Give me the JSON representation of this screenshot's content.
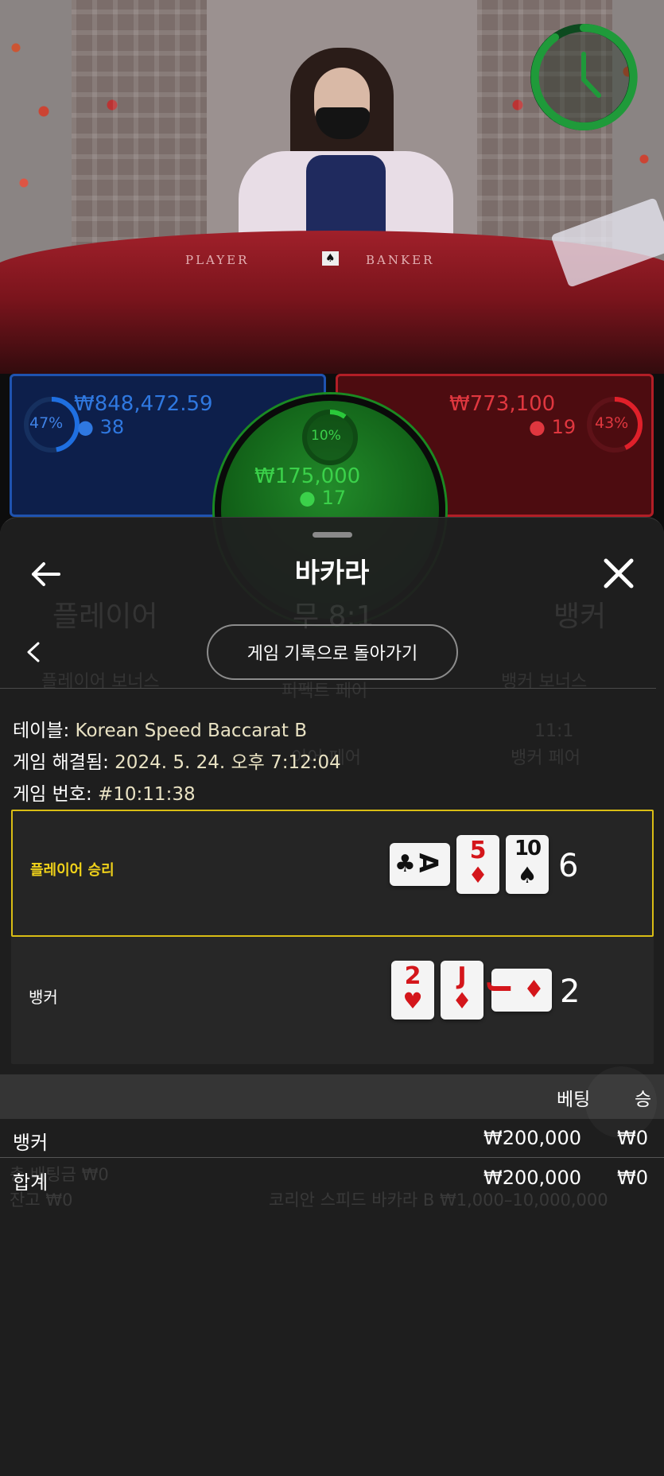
{
  "video": {
    "felt_left": "PLAYER",
    "felt_right": "BANKER"
  },
  "bets": {
    "player": {
      "percent": "47%",
      "amount": "₩848,472.59",
      "count": "38",
      "fill": 0.47,
      "color": "#1f6fe0"
    },
    "banker": {
      "percent": "43%",
      "amount": "₩773,100",
      "count": "19",
      "fill": 0.43,
      "color": "#e0202a"
    },
    "tie": {
      "percent": "10%",
      "amount": "₩175,000",
      "count": "17",
      "fill": 0.1,
      "color": "#2ac93a"
    }
  },
  "background_ui": {
    "player_label": "플레이어",
    "tie_label": "무 8:1",
    "banker_label": "뱅커",
    "player_bonus": "플레이어 보너스",
    "perfect_pair": "퍼펙트 페어",
    "banker_bonus": "뱅커 보너스",
    "banker_pair_odds": "11:1",
    "banker_pair": "뱅커 페어",
    "player_pair": "이어 페어",
    "total_bet": "총 배팅금 ₩0",
    "balance": "잔고 ₩0",
    "table_limits": "코리안 스피드 바카라 B ₩1,000–10,000,000"
  },
  "sheet": {
    "title": "바카라",
    "history_button": "게임 기록으로 돌아가기",
    "table_label": "테이블: ",
    "table_value": "Korean Speed Baccarat B",
    "resolved_label": "게임 해결됨: ",
    "resolved_value": "2024. 5. 24. 오후 7:12:04",
    "game_no_label": "게임 번호: ",
    "game_no_value": "#10:11:38"
  },
  "results": {
    "player": {
      "label": "플레이어 승리",
      "score": "6",
      "cards": [
        {
          "rank": "A",
          "suit": "♣",
          "color": "black",
          "orientation": "sideways"
        },
        {
          "rank": "5",
          "suit": "♦",
          "color": "red",
          "orientation": "upright"
        },
        {
          "rank": "10",
          "suit": "♠",
          "color": "black",
          "orientation": "upright"
        }
      ]
    },
    "banker": {
      "label": "뱅커",
      "score": "2",
      "cards": [
        {
          "rank": "2",
          "suit": "♥",
          "color": "red",
          "orientation": "upright"
        },
        {
          "rank": "J",
          "suit": "♦",
          "color": "red",
          "orientation": "upright"
        },
        {
          "rank": "J",
          "suit": "♦",
          "color": "red",
          "orientation": "sideways"
        }
      ]
    }
  },
  "bets_table": {
    "col_bet": "베팅",
    "col_win": "승",
    "rows": [
      {
        "label": "뱅커",
        "bet": "₩200,000",
        "win": "₩0"
      },
      {
        "label": "합계",
        "bet": "₩200,000",
        "win": "₩0"
      }
    ]
  },
  "colors": {
    "win_border": "#d9bd14",
    "win_label": "#f0d21a",
    "timer": "#1f9a3a"
  }
}
